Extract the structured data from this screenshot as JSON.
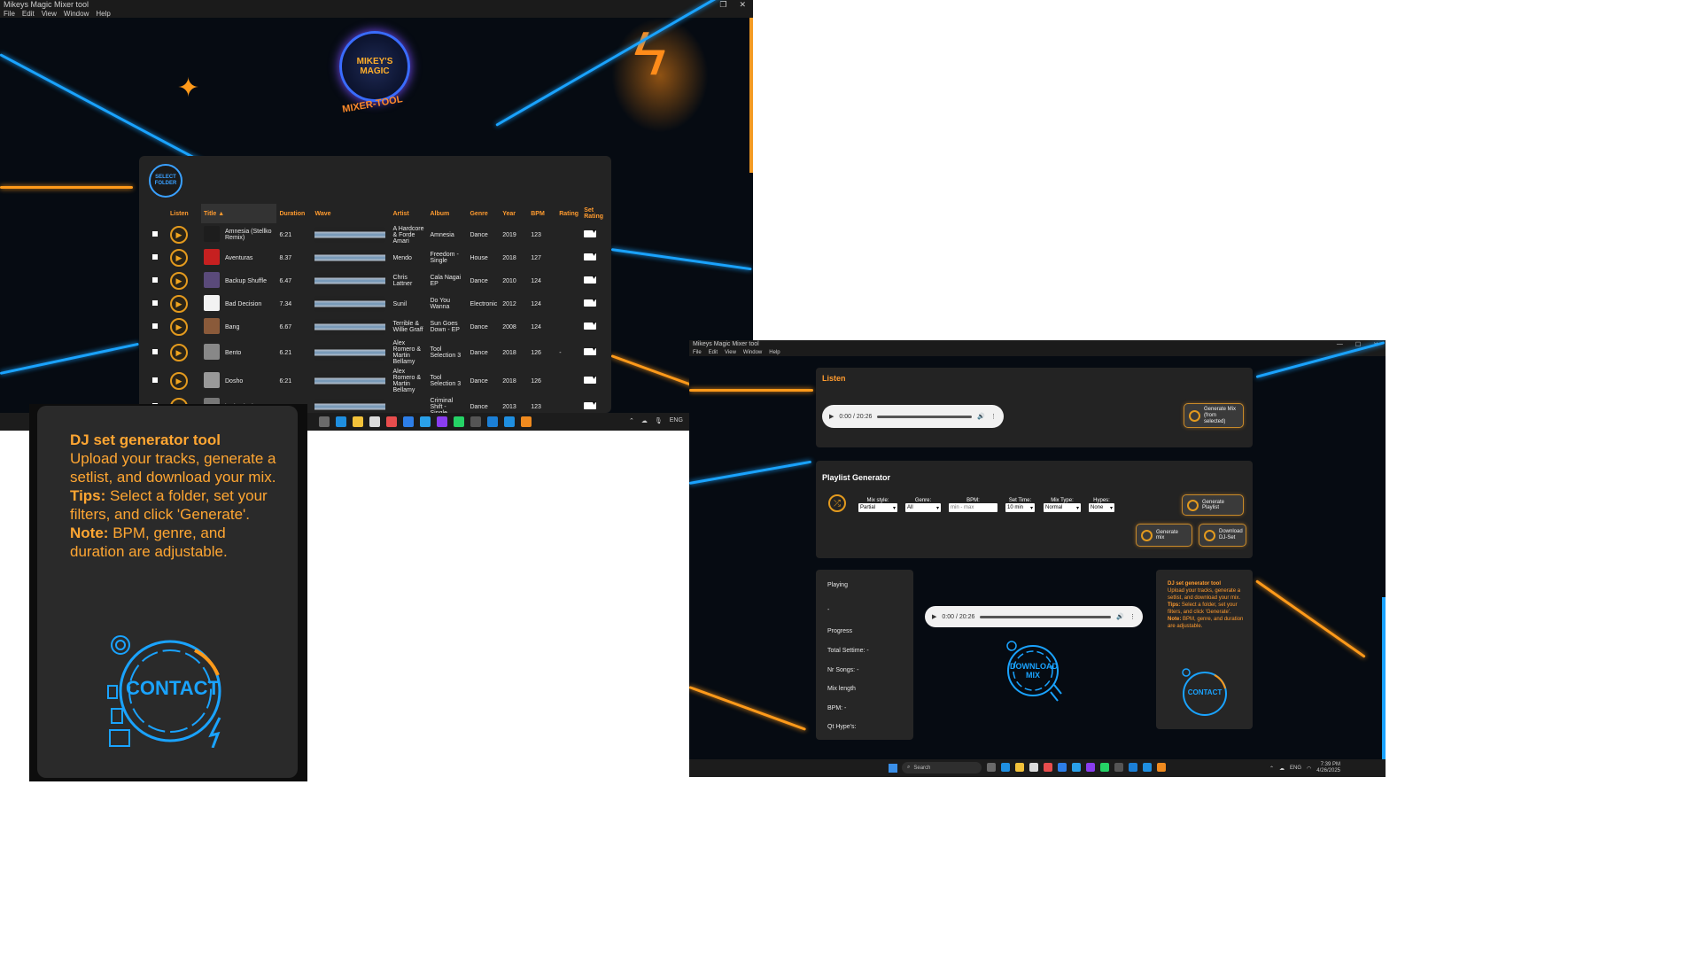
{
  "win1": {
    "title": "Mikeys Magic Mixer tool",
    "menu": [
      "File",
      "Edit",
      "View",
      "Window",
      "Help"
    ],
    "logo_top": "MIKEY'S MAGIC",
    "logo_bottom": "MIXER-TOOL",
    "select_folder": "SELECT FOLDER",
    "columns": [
      "Listen",
      "Title ▲",
      "Duration",
      "Wave",
      "Artist",
      "Album",
      "Genre",
      "Year",
      "BPM",
      "Rating",
      "Set Rating"
    ],
    "tracks": [
      {
        "title": "Amnesia (Stellko Remix)",
        "duration": "6:21",
        "artist": "A Hardcore & Forde Amari",
        "album": "Amnesia",
        "genre": "Dance",
        "year": "2019",
        "bpm": "123",
        "rating": "",
        "cover": "#1d1d1d"
      },
      {
        "title": "Aventuras",
        "duration": "8.37",
        "artist": "Mendo",
        "album": "Freedom - Single",
        "genre": "House",
        "year": "2018",
        "bpm": "127",
        "rating": "",
        "cover": "#c62020"
      },
      {
        "title": "Backup Shuffle",
        "duration": "6.47",
        "artist": "Chris Lattner",
        "album": "Cala Nagai EP",
        "genre": "Dance",
        "year": "2010",
        "bpm": "124",
        "rating": "",
        "cover": "#5a4a7a"
      },
      {
        "title": "Bad Decision",
        "duration": "7.34",
        "artist": "Sunil",
        "album": "Do You Wanna",
        "genre": "Electronic",
        "year": "2012",
        "bpm": "124",
        "rating": "",
        "cover": "#f2f2f2"
      },
      {
        "title": "Bang",
        "duration": "6.67",
        "artist": "Terrible & Willie Graff",
        "album": "Sun Goes Down - EP",
        "genre": "Dance",
        "year": "2008",
        "bpm": "124",
        "rating": "",
        "cover": "#8a5a3a"
      },
      {
        "title": "Bento",
        "duration": "6.21",
        "artist": "Alex Romero & Martin Bellamy",
        "album": "Tool Selection 3",
        "genre": "Dance",
        "year": "2018",
        "bpm": "126",
        "rating": "-",
        "cover": "#888888"
      },
      {
        "title": "Dosho",
        "duration": "6:21",
        "artist": "Alex Romero & Martin Bellamy",
        "album": "Tool Selection 3",
        "genre": "Dance",
        "year": "2018",
        "bpm": "126",
        "rating": "",
        "cover": "#999999"
      },
      {
        "title": "iO (Mulen)",
        "duration": "",
        "artist": "",
        "album": "Criminal Shift - Single",
        "genre": "Dance",
        "year": "2013",
        "bpm": "123",
        "rating": "",
        "cover": "#777777"
      }
    ]
  },
  "info": {
    "heading": "DJ set generator tool",
    "line1": "Upload your tracks, generate a setlist, and download your mix.",
    "tips_label": "Tips:",
    "tips": "Select a folder, set your filters, and click 'Generate'.",
    "note_label": "Note:",
    "note": "BPM, genre, and duration are adjustable.",
    "contact": "CONTACT"
  },
  "win2": {
    "title": "Mikeys Magic Mixer tool",
    "menu": [
      "File",
      "Edit",
      "View",
      "Window",
      "Help"
    ],
    "listen_title": "Listen",
    "audio_time": "0:00 / 20:26",
    "gen_mix_label": "Generate Mix",
    "gen_mix_sub": "(from selected)",
    "playlist_title": "Playlist Generator",
    "filters": [
      {
        "label": "Mix style:",
        "value": "Partial"
      },
      {
        "label": "Genre:",
        "value": "All"
      },
      {
        "label": "BPM:",
        "value": "min - max"
      },
      {
        "label": "Set Time:",
        "value": "10 min"
      },
      {
        "label": "Mix Type:",
        "value": "Normal"
      },
      {
        "label": "Hypes:",
        "value": "None"
      }
    ],
    "gen_playlist": "Generate Playlist",
    "gen_mix2": "Generate mix",
    "download_set": "Download DJ-Set",
    "playing": "Playing",
    "playing_value": "-",
    "progress": "Progress",
    "total_settime": "Total Settime: -",
    "nr_songs": "Nr Songs: -",
    "mix_length": "Mix length",
    "bpm": "BPM: -",
    "qt_hypes": "Qt Hype's:",
    "audio2_time": "0:00 / 20:26",
    "download_mix": "DOWNLOAD MIX",
    "info_heading": "DJ set generator tool",
    "info_body": "Upload your tracks, generate a setlist, and download your mix.",
    "info_tips_label": "Tips:",
    "info_tips": "Select a folder, set your filters, and click 'Generate'.",
    "info_note_label": "Note:",
    "info_note": "BPM, genre, and duration are adjustable.",
    "contact": "CONTACT"
  },
  "taskbar2": {
    "search": "Search",
    "lang": "ENG",
    "time": "7:39 PM",
    "date": "4/26/2025"
  },
  "colors": {
    "accent": "#ff9b2f",
    "neon_blue": "#1aa3ff",
    "panel": "#232323"
  }
}
